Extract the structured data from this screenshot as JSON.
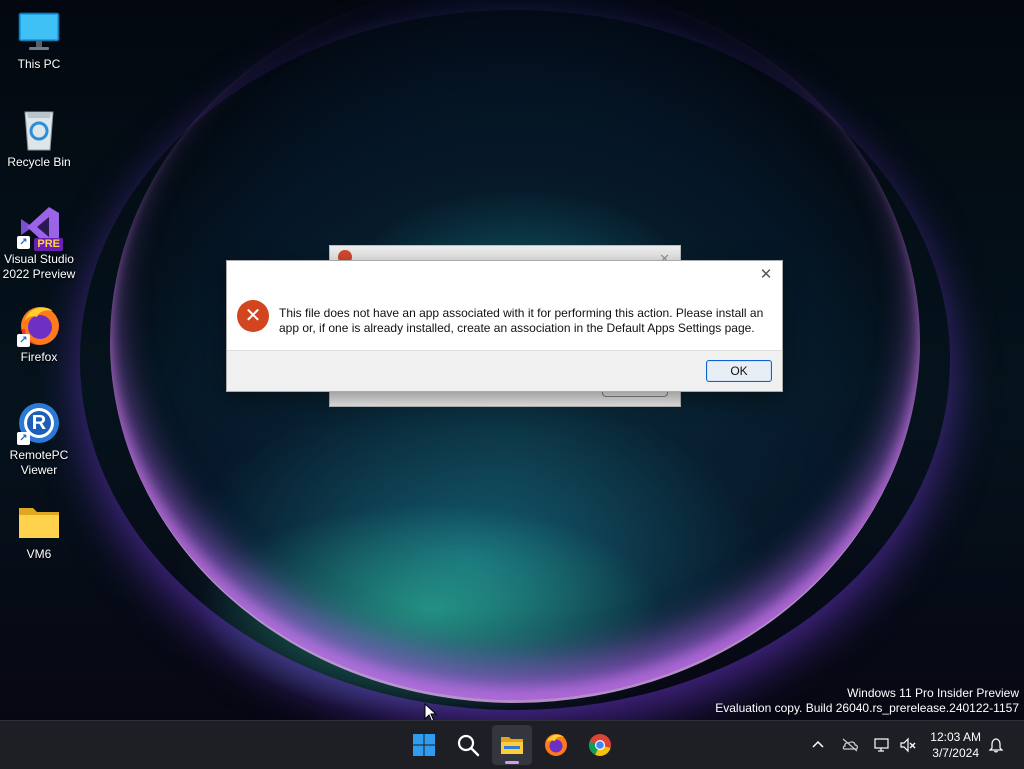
{
  "desktop": {
    "icons": [
      {
        "label": "This PC",
        "icon": "monitor-icon"
      },
      {
        "label": "Recycle Bin",
        "icon": "recycle-bin-icon"
      },
      {
        "label": "Visual Studio\n2022 Preview",
        "label_line1": "Visual Studio",
        "label_line2": "2022 Preview",
        "icon": "visual-studio-icon",
        "badge": "PRE"
      },
      {
        "label": "Firefox",
        "icon": "firefox-icon"
      },
      {
        "label_line1": "RemotePC",
        "label_line2": "Viewer",
        "icon": "remotepc-icon",
        "glyph": "R"
      },
      {
        "label": "VM6",
        "icon": "folder-icon"
      }
    ],
    "watermark": {
      "line1": "Windows 11 Pro Insider Preview",
      "line2": "Evaluation copy. Build 26040.rs_prerelease.240122-1157"
    }
  },
  "dialog": {
    "message": "This file does not have an app associated with it for performing this action. Please install an app or, if one is already installed, create an association in the Default Apps Settings page.",
    "ok_label": "OK",
    "close_glyph": "✕",
    "error_glyph": "✕"
  },
  "taskbar": {
    "apps": [
      "start-icon",
      "search-icon",
      "file-explorer-icon",
      "firefox-icon",
      "chrome-icon"
    ],
    "clock": {
      "time": "12:03 AM",
      "date": "3/7/2024"
    }
  },
  "colors": {
    "accent": "#0a64d2",
    "error": "#d2451f",
    "taskbar": "#1d1f24"
  }
}
